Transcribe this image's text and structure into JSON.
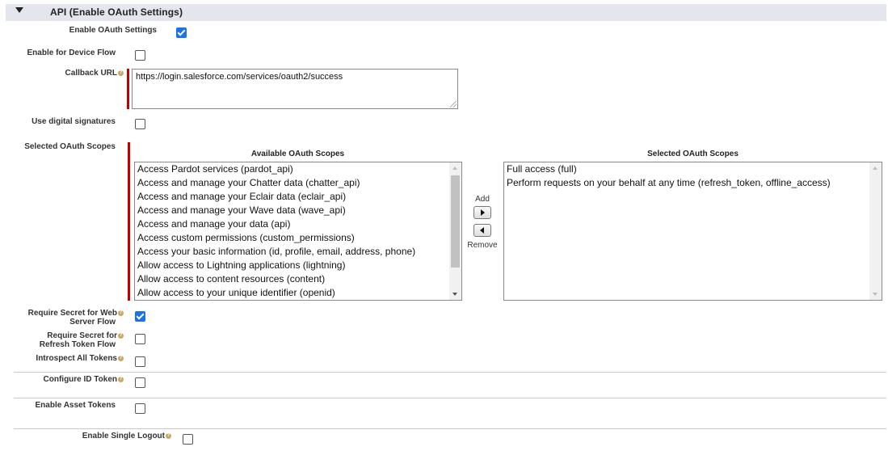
{
  "section": {
    "title": "API (Enable OAuth Settings)",
    "expanded": true
  },
  "fields": {
    "enable_oauth": {
      "label": "Enable OAuth Settings",
      "checked": true
    },
    "device_flow": {
      "label": "Enable for Device Flow",
      "checked": false
    },
    "callback_url": {
      "label": "Callback URL",
      "value": "https://login.salesforce.com/services/oauth2/success"
    },
    "digital_signatures": {
      "label": "Use digital signatures",
      "checked": false
    },
    "scopes": {
      "label": "Selected OAuth Scopes"
    },
    "secret_web": {
      "label_line1": "Require Secret for Web",
      "label_line2": "Server Flow",
      "checked": true
    },
    "secret_refresh": {
      "label_line1": "Require Secret for",
      "label_line2": "Refresh Token Flow",
      "checked": false
    },
    "introspect": {
      "label": "Introspect All Tokens",
      "checked": false
    },
    "id_token": {
      "label": "Configure ID Token",
      "checked": false
    },
    "asset_tokens": {
      "label": "Enable Asset Tokens",
      "checked": false
    },
    "single_logout": {
      "label": "Enable Single Logout",
      "checked": false
    }
  },
  "available_scopes": {
    "heading": "Available OAuth Scopes",
    "options": [
      "Access Pardot services (pardot_api)",
      "Access and manage your Chatter data (chatter_api)",
      "Access and manage your Eclair data (eclair_api)",
      "Access and manage your Wave data (wave_api)",
      "Access and manage your data (api)",
      "Access custom permissions (custom_permissions)",
      "Access your basic information (id, profile, email, address, phone)",
      "Allow access to Lightning applications (lightning)",
      "Allow access to content resources (content)",
      "Allow access to your unique identifier (openid)"
    ]
  },
  "selected_scopes": {
    "heading": "Selected OAuth Scopes",
    "options": [
      "Full access (full)",
      "Perform requests on your behalf at any time (refresh_token, offline_access)"
    ]
  },
  "buttons": {
    "add_label": "Add",
    "remove_label": "Remove"
  },
  "icons": {
    "help": "help-icon",
    "toggle": "triangle-down-icon"
  },
  "colors": {
    "required_bar": "#c00000",
    "checkbox_checked": "#1a73e8",
    "header_bg": "#e4e6ee"
  }
}
